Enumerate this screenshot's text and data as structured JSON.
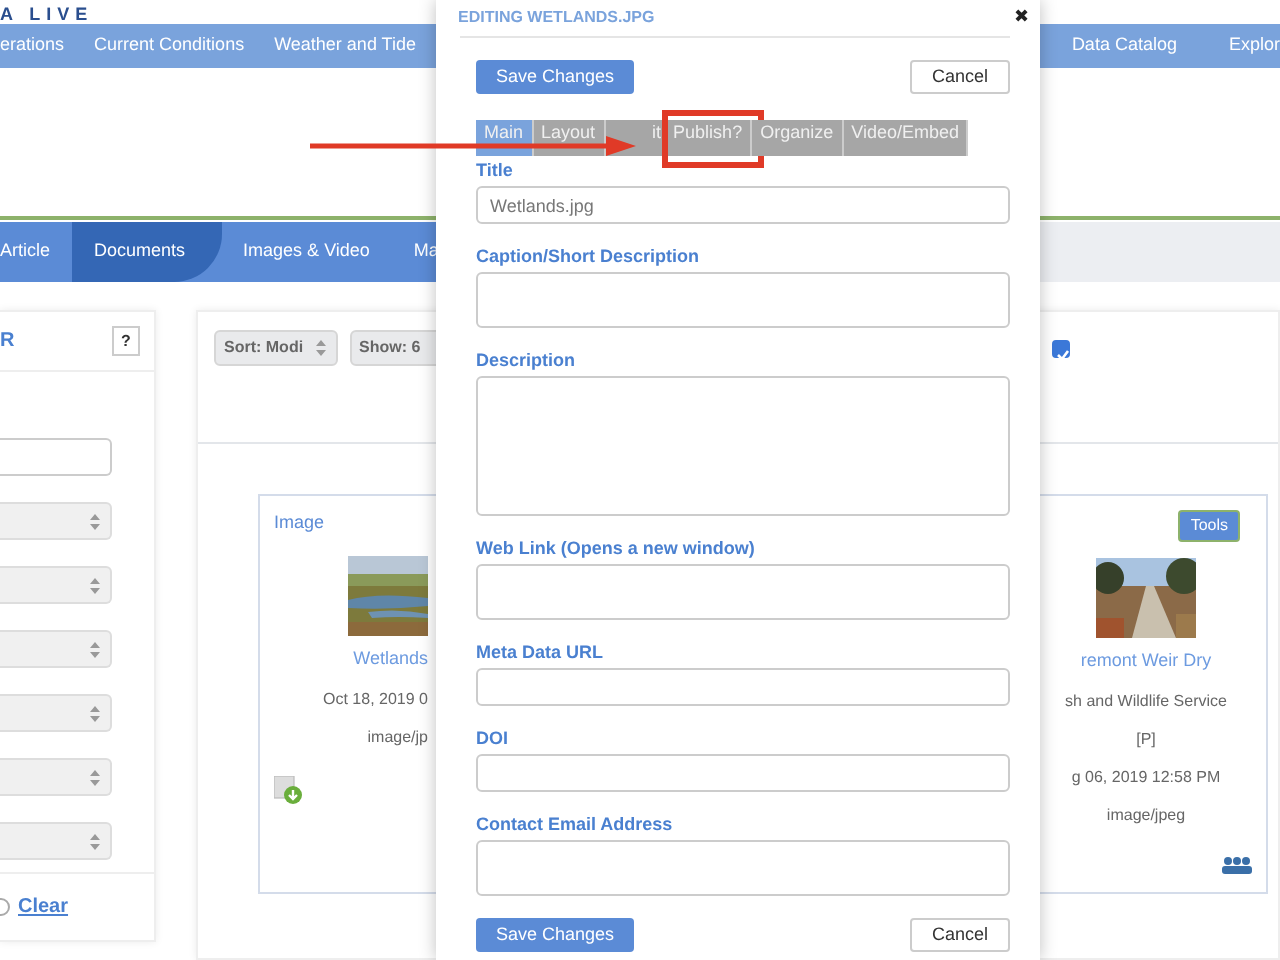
{
  "site": {
    "logo": "A LIVE"
  },
  "main_nav_left": [
    "erations",
    "Current Conditions",
    "Weather and Tide"
  ],
  "main_nav_right": [
    "Data Catalog",
    "Explor"
  ],
  "section_tabs": [
    {
      "label": "Article",
      "selected": false
    },
    {
      "label": "Documents",
      "selected": true
    },
    {
      "label": "Images & Video",
      "selected": false
    },
    {
      "label": "Ma",
      "selected": false
    }
  ],
  "filter_panel": {
    "title": "R",
    "help_button": "?",
    "fields": [
      {
        "kind": "input"
      },
      {
        "kind": "select"
      },
      {
        "kind": "select"
      },
      {
        "kind": "select"
      },
      {
        "kind": "select"
      },
      {
        "kind": "select"
      },
      {
        "kind": "select"
      }
    ],
    "clear": {
      "label": "Clear",
      "checked": false
    }
  },
  "toolbar": {
    "sort": "Sort: Modi",
    "show": "Show: 6",
    "checkbox_checked": true
  },
  "cards": [
    {
      "type_label": "Image",
      "title": "Wetlands",
      "lines": [
        "Oct 18, 2019 0",
        "image/jp"
      ]
    },
    {
      "tools_button": "Tools",
      "title": "remont Weir Dry",
      "lines": [
        "sh and Wildlife Service",
        "[P]",
        "g 06, 2019 12:58 PM",
        "image/jpeg"
      ]
    }
  ],
  "modal": {
    "title": "EDITING WETLANDS.JPG",
    "close": "✖",
    "save": "Save Changes",
    "cancel": "Cancel",
    "tabs": [
      {
        "label": "Main",
        "selected": true,
        "highlighted": false
      },
      {
        "label": "Layout",
        "selected": false,
        "highlighted": false
      },
      {
        "label": "it",
        "selected": false,
        "highlighted": false
      },
      {
        "label": "Publish?",
        "selected": false,
        "highlighted": true
      },
      {
        "label": "Organize",
        "selected": false,
        "highlighted": false
      },
      {
        "label": "Video/Embed",
        "selected": false,
        "highlighted": false
      }
    ],
    "fields": [
      {
        "label": "Title",
        "kind": "input",
        "value": "Wetlands.jpg"
      },
      {
        "label": "Caption/Short Description",
        "kind": "textarea"
      },
      {
        "label": "Description",
        "kind": "tall-textarea"
      },
      {
        "label": "Web Link (Opens a new window)",
        "kind": "textarea"
      },
      {
        "label": "Meta Data URL",
        "kind": "input"
      },
      {
        "label": "DOI",
        "kind": "input"
      },
      {
        "label": "Contact Email Address",
        "kind": "textarea"
      }
    ],
    "footer_save": "Save Changes",
    "footer_cancel": "Cancel"
  }
}
